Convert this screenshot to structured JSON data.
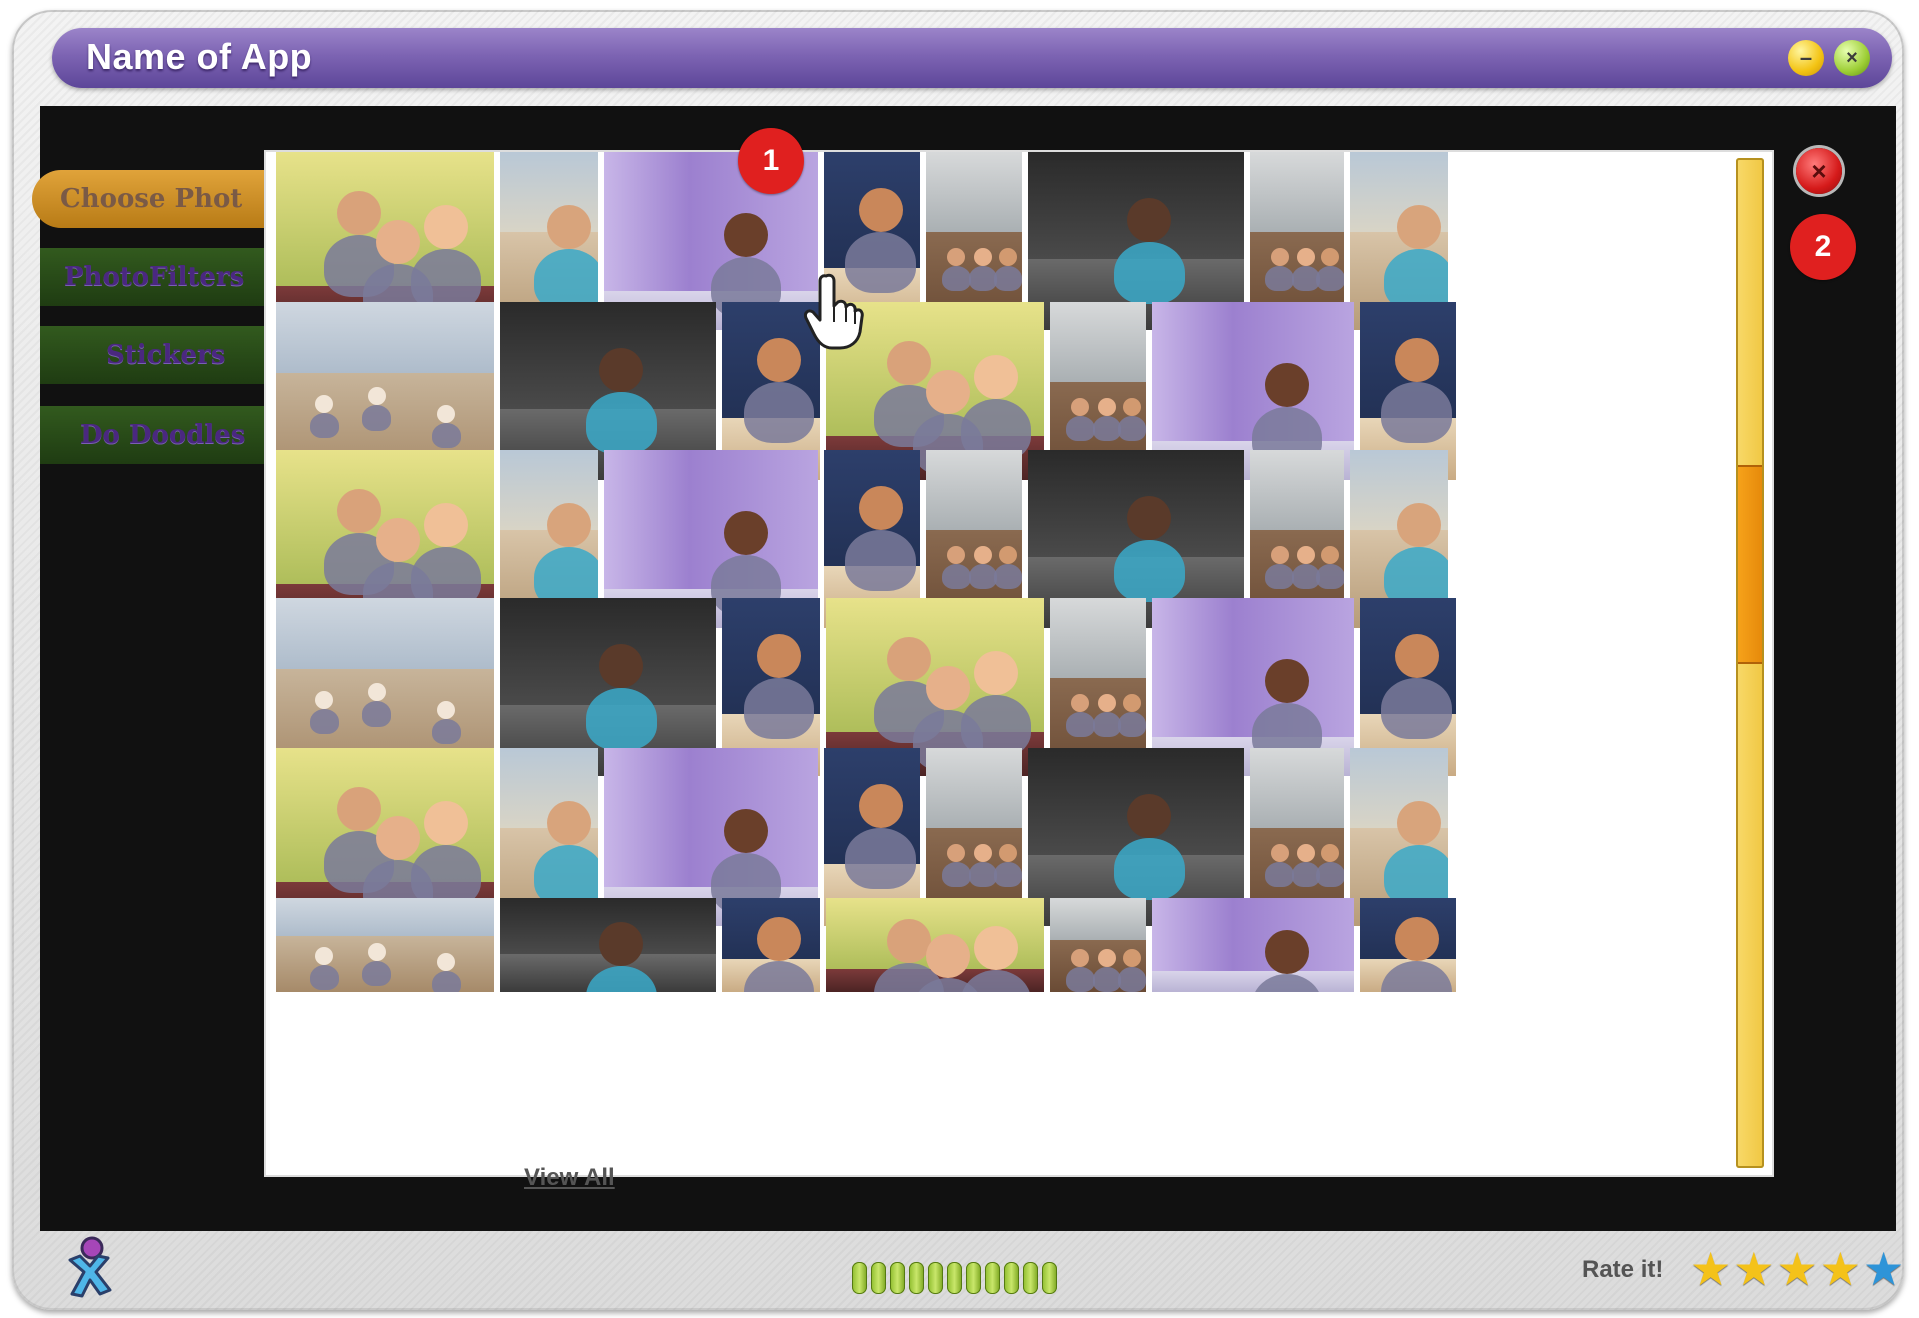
{
  "window": {
    "title": "Name of App"
  },
  "sidebar": {
    "items": [
      {
        "label": "Choose Phot"
      },
      {
        "label": "PhotoFilters"
      },
      {
        "label": "Stickers"
      },
      {
        "label": "Do Doodles"
      }
    ]
  },
  "gallery": {
    "view_all_label": "View All",
    "callouts": {
      "one": "1",
      "two": "2"
    },
    "close_icon": "×"
  },
  "footer": {
    "progress_segments": 11,
    "rate_label": "Rate it!",
    "rating": 4,
    "rating_max": 5
  },
  "colors": {
    "titlebar": "#7d64b3",
    "selection": "#9ad31d",
    "scrollbar": "#f0c742",
    "scroll_thumb": "#e68a0b",
    "callout": "#e0201f"
  },
  "icons": [
    "minimize-icon",
    "close-icon",
    "cursor-hand-icon",
    "app-logo-icon",
    "star-icon"
  ]
}
